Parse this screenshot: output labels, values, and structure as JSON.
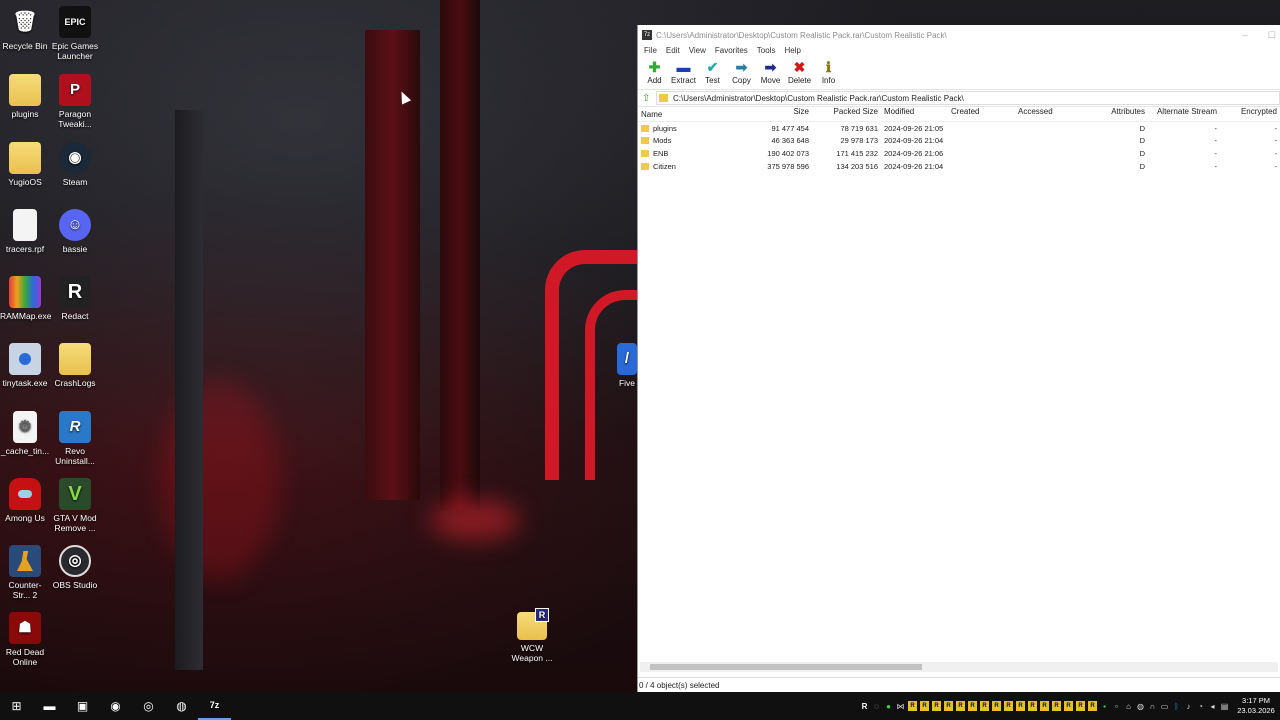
{
  "desktop": {
    "icons": [
      {
        "label": "Recycle Bin",
        "icon": "recycle-bin-icon"
      },
      {
        "label": "Epic Games Launcher",
        "icon": "epic-games-icon",
        "glyph": "EPIC"
      },
      {
        "label": "plugins",
        "icon": "folder-icon"
      },
      {
        "label": "Paragon Tweaki...",
        "icon": "paragon-icon",
        "glyph": "P"
      },
      {
        "label": "YugioOS",
        "icon": "folder-icon"
      },
      {
        "label": "Steam",
        "icon": "steam-icon"
      },
      {
        "label": "tracers.rpf",
        "icon": "file-icon"
      },
      {
        "label": "bassie",
        "icon": "discord-icon"
      },
      {
        "label": "RAMMap.exe",
        "icon": "rammap-icon"
      },
      {
        "label": "Redact",
        "icon": "redact-icon",
        "glyph": "R"
      },
      {
        "label": "tinytask.exe",
        "icon": "tinytask-icon"
      },
      {
        "label": "CrashLogs",
        "icon": "folder-icon"
      },
      {
        "label": "_cache_tin...",
        "icon": "file-gear-icon"
      },
      {
        "label": "Revo Uninstall...",
        "icon": "revo-icon",
        "glyph": "R"
      },
      {
        "label": "Among Us",
        "icon": "among-us-icon"
      },
      {
        "label": "GTA V Mod Remove ...",
        "icon": "gta-v-icon",
        "glyph": "V"
      },
      {
        "label": "Counter-Str... 2",
        "icon": "counter-strike-icon"
      },
      {
        "label": "OBS Studio",
        "icon": "obs-icon"
      },
      {
        "label": "Red Dead Online",
        "icon": "red-dead-icon"
      },
      {
        "label": "WCW Weapon ...",
        "icon": "rar-archive-icon",
        "glyph": "R"
      },
      {
        "label": "Five",
        "icon": "fivem-icon"
      }
    ]
  },
  "window": {
    "title": "C:\\Users\\Administrator\\Desktop\\Custom Realistic Pack.rar\\Custom Realistic Pack\\",
    "app_icon_label": "7z",
    "menu": [
      "File",
      "Edit",
      "View",
      "Favorites",
      "Tools",
      "Help"
    ],
    "toolbar": [
      {
        "label": "Add",
        "icon": "add-icon",
        "glyph": "✚",
        "color": "#2fae2f"
      },
      {
        "label": "Extract",
        "icon": "extract-icon",
        "glyph": "▬",
        "color": "#1d3fae"
      },
      {
        "label": "Test",
        "icon": "test-icon",
        "glyph": "✔",
        "color": "#2aa8a8"
      },
      {
        "label": "Copy",
        "icon": "copy-icon",
        "glyph": "➡",
        "color": "#2a7f9d"
      },
      {
        "label": "Move",
        "icon": "move-icon",
        "glyph": "➡",
        "color": "#1d2a8f"
      },
      {
        "label": "Delete",
        "icon": "delete-icon",
        "glyph": "✖",
        "color": "#d01818"
      },
      {
        "label": "Info",
        "icon": "info-icon",
        "glyph": "ℹ",
        "color": "#8a7a10"
      }
    ],
    "address": "C:\\Users\\Administrator\\Desktop\\Custom Realistic Pack.rar\\Custom Realistic Pack\\",
    "columns": {
      "name": "Name",
      "size": "Size",
      "packed": "Packed Size",
      "modified": "Modified",
      "created": "Created",
      "accessed": "Accessed",
      "attributes": "Attributes",
      "alt_stream": "Alternate Stream",
      "encrypted": "Encrypted"
    },
    "rows": [
      {
        "name": "plugins",
        "size": "91 477 454",
        "packed": "78 719 631",
        "modified": "2024-09-26 21:05",
        "created": "",
        "accessed": "",
        "attributes": "D",
        "alt_stream": "-",
        "encrypted": "-"
      },
      {
        "name": "Mods",
        "size": "46 363 648",
        "packed": "29 978 173",
        "modified": "2024-09-26 21:04",
        "created": "",
        "accessed": "",
        "attributes": "D",
        "alt_stream": "-",
        "encrypted": "-"
      },
      {
        "name": "ENB",
        "size": "190 402 073",
        "packed": "171 415 232",
        "modified": "2024-09-26 21:06",
        "created": "",
        "accessed": "",
        "attributes": "D",
        "alt_stream": "-",
        "encrypted": "-"
      },
      {
        "name": "Citizen",
        "size": "375 978 596",
        "packed": "134 203 516",
        "modified": "2024-09-26 21:04",
        "created": "",
        "accessed": "",
        "attributes": "D",
        "alt_stream": "-",
        "encrypted": "-"
      }
    ],
    "status": "0 / 4 object(s) selected"
  },
  "taskbar": {
    "apps": [
      {
        "name": "start-button",
        "glyph": "⊞"
      },
      {
        "name": "file-explorer-icon",
        "glyph": "▬"
      },
      {
        "name": "store-icon",
        "glyph": "▣"
      },
      {
        "name": "browser-icon",
        "glyph": "◉"
      },
      {
        "name": "obs-taskbar-icon",
        "glyph": "◎"
      },
      {
        "name": "chrome-icon",
        "glyph": "◍"
      },
      {
        "name": "7zip-taskbar-icon",
        "glyph": "7z"
      }
    ],
    "clock_time": "3:17 PM",
    "clock_date": "23.03.2026"
  }
}
